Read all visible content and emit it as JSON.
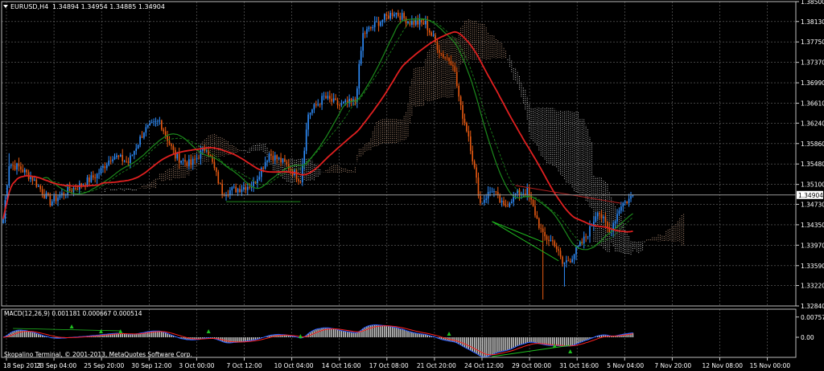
{
  "header": {
    "symbol_label": "EURUSD,H4",
    "ohlc_label": "1.34894 1.34954 1.34885 1.34904"
  },
  "price_axis": {
    "ticks": [
      "1.38500",
      "1.38130",
      "1.37750",
      "1.37370",
      "1.36990",
      "1.36610",
      "1.36240",
      "1.35860",
      "1.35480",
      "1.35100",
      "1.34730",
      "1.34350",
      "1.33970",
      "1.33590",
      "1.33220",
      "1.32840"
    ],
    "current_price": "1.34904"
  },
  "macd_axis": {
    "label": "MACD(12,26,9) 0.001181 0.000667 0.000514",
    "ticks": [
      "0.00757",
      "0.00"
    ]
  },
  "time_axis": {
    "ticks": [
      "18 Sep 2013",
      "23 Sep 04:00",
      "25 Sep 20:00",
      "30 Sep 12:00",
      "3 Oct 00:00",
      "7 Oct 12:00",
      "10 Oct 04:00",
      "14 Oct 16:00",
      "17 Oct 08:00",
      "21 Oct 20:00",
      "24 Oct 12:00",
      "29 Oct 00:00",
      "31 Oct 16:00",
      "5 Nov 04:00",
      "7 Nov 20:00",
      "12 Nov 08:00",
      "15 Nov 00:00"
    ]
  },
  "copyright": "Skopalino Terminal, © 2001-2013, MetaQuotes Software Corp.",
  "colors": {
    "background": "#000000",
    "grid": "#6a6a6a",
    "bull_candle": "#2f8fff",
    "bear_candle": "#e85a12",
    "slow_ma": "#e02020",
    "fast_ma": "#1c8a1c",
    "ichimoku_cloud_bull": "#e7b898",
    "ichimoku_cloud_bear": "#ffffff",
    "macd_line": "#2c5cff",
    "signal_line": "#ff2020",
    "histogram": "#d8d8d8",
    "divergence": "#20c020"
  },
  "chart_data": [
    {
      "type": "candlestick",
      "title": "EURUSD,H4",
      "ylim": [
        1.3284,
        1.385
      ],
      "x_range_bars": [
        0,
        354
      ],
      "anchors": [
        [
          0,
          1.3446
        ],
        [
          3,
          1.3548
        ],
        [
          8,
          1.3542
        ],
        [
          15,
          1.3521
        ],
        [
          24,
          1.3477
        ],
        [
          32,
          1.3496
        ],
        [
          40,
          1.3509
        ],
        [
          48,
          1.3528
        ],
        [
          56,
          1.3564
        ],
        [
          64,
          1.3551
        ],
        [
          72,
          1.361
        ],
        [
          80,
          1.3628
        ],
        [
          88,
          1.3562
        ],
        [
          96,
          1.3547
        ],
        [
          104,
          1.3581
        ],
        [
          112,
          1.3495
        ],
        [
          120,
          1.3502
        ],
        [
          128,
          1.3511
        ],
        [
          136,
          1.3567
        ],
        [
          144,
          1.3549
        ],
        [
          152,
          1.3519
        ],
        [
          156,
          1.3641
        ],
        [
          164,
          1.3672
        ],
        [
          172,
          1.3657
        ],
        [
          180,
          1.3664
        ],
        [
          184,
          1.3789
        ],
        [
          192,
          1.3812
        ],
        [
          200,
          1.3831
        ],
        [
          208,
          1.3812
        ],
        [
          216,
          1.3809
        ],
        [
          224,
          1.3753
        ],
        [
          230,
          1.3737
        ],
        [
          234,
          1.3651
        ],
        [
          238,
          1.3601
        ],
        [
          244,
          1.3475
        ],
        [
          250,
          1.3501
        ],
        [
          256,
          1.3467
        ],
        [
          262,
          1.3492
        ],
        [
          268,
          1.3498
        ],
        [
          276,
          1.3414
        ],
        [
          282,
          1.3401
        ],
        [
          286,
          1.3362
        ],
        [
          290,
          1.3372
        ],
        [
          296,
          1.3401
        ],
        [
          300,
          1.3426
        ],
        [
          304,
          1.3464
        ],
        [
          310,
          1.3421
        ],
        [
          316,
          1.3473
        ],
        [
          320,
          1.3482
        ],
        [
          322,
          1.349
        ]
      ],
      "sma_slow_period": 50,
      "sma_fast_period": 21,
      "ichimoku_shift": 26,
      "current_price": 1.34904
    },
    {
      "type": "bar",
      "title": "MACD(12,26,9)",
      "series": [
        {
          "name": "MACD",
          "value": 0.001181
        },
        {
          "name": "Signal",
          "value": 0.000667
        },
        {
          "name": "Histogram",
          "value": 0.000514
        }
      ],
      "ylim": [
        -0.0075,
        0.0105
      ]
    }
  ]
}
